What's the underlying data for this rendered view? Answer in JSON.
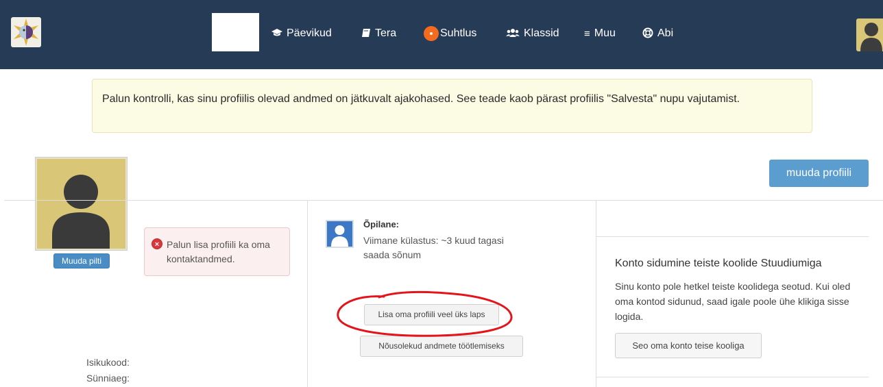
{
  "nav": {
    "items": [
      {
        "label": "Päevikud",
        "icon": "graduation-cap-icon"
      },
      {
        "label": "Tera",
        "icon": "book-icon"
      },
      {
        "label": "Suhtlus",
        "icon": "message-dot-icon"
      },
      {
        "label": "Klassid",
        "icon": "users-icon"
      },
      {
        "label": "Muu",
        "icon": "menu-bars-icon"
      },
      {
        "label": "Abi",
        "icon": "life-ring-icon"
      }
    ]
  },
  "notice": {
    "text": "Palun kontrolli, kas sinu profiilis olevad andmed on jätkuvalt ajakohased. See teade kaob pärast profiilis \"Salvesta\" nupu vajutamist."
  },
  "profile": {
    "change_picture_label": "Muuda pilti",
    "edit_profile_label": "muuda profiili",
    "error_text": "Palun lisa profiili ka oma kontaktandmed.",
    "fields": {
      "isikukood_label": "Isikukood:",
      "synniaeg_label": "Sünniaeg:"
    }
  },
  "student": {
    "role": "Õpilane:",
    "last_visit": "Viimane külastus: ~3 kuud tagasi",
    "send_message": "saada sõnum",
    "add_child_label": "Lisa oma profiili veel üks laps",
    "consents_label": "Nõusolekud andmete töötlemiseks"
  },
  "account_link": {
    "title": "Konto sidumine teiste koolide Stuudiumiga",
    "description": "Sinu konto pole hetkel teiste koolidega seotud. Kui oled oma kontod sidunud, saad igale poole ühe klikiga sisse logida.",
    "button_label": "Seo oma konto teise kooliga"
  },
  "colors": {
    "topbar": "#263c56",
    "accent_blue": "#5b9dcf",
    "annotation_red": "#e3141b",
    "notice_bg": "#fcfbe3",
    "error_bg": "#fcefef"
  }
}
